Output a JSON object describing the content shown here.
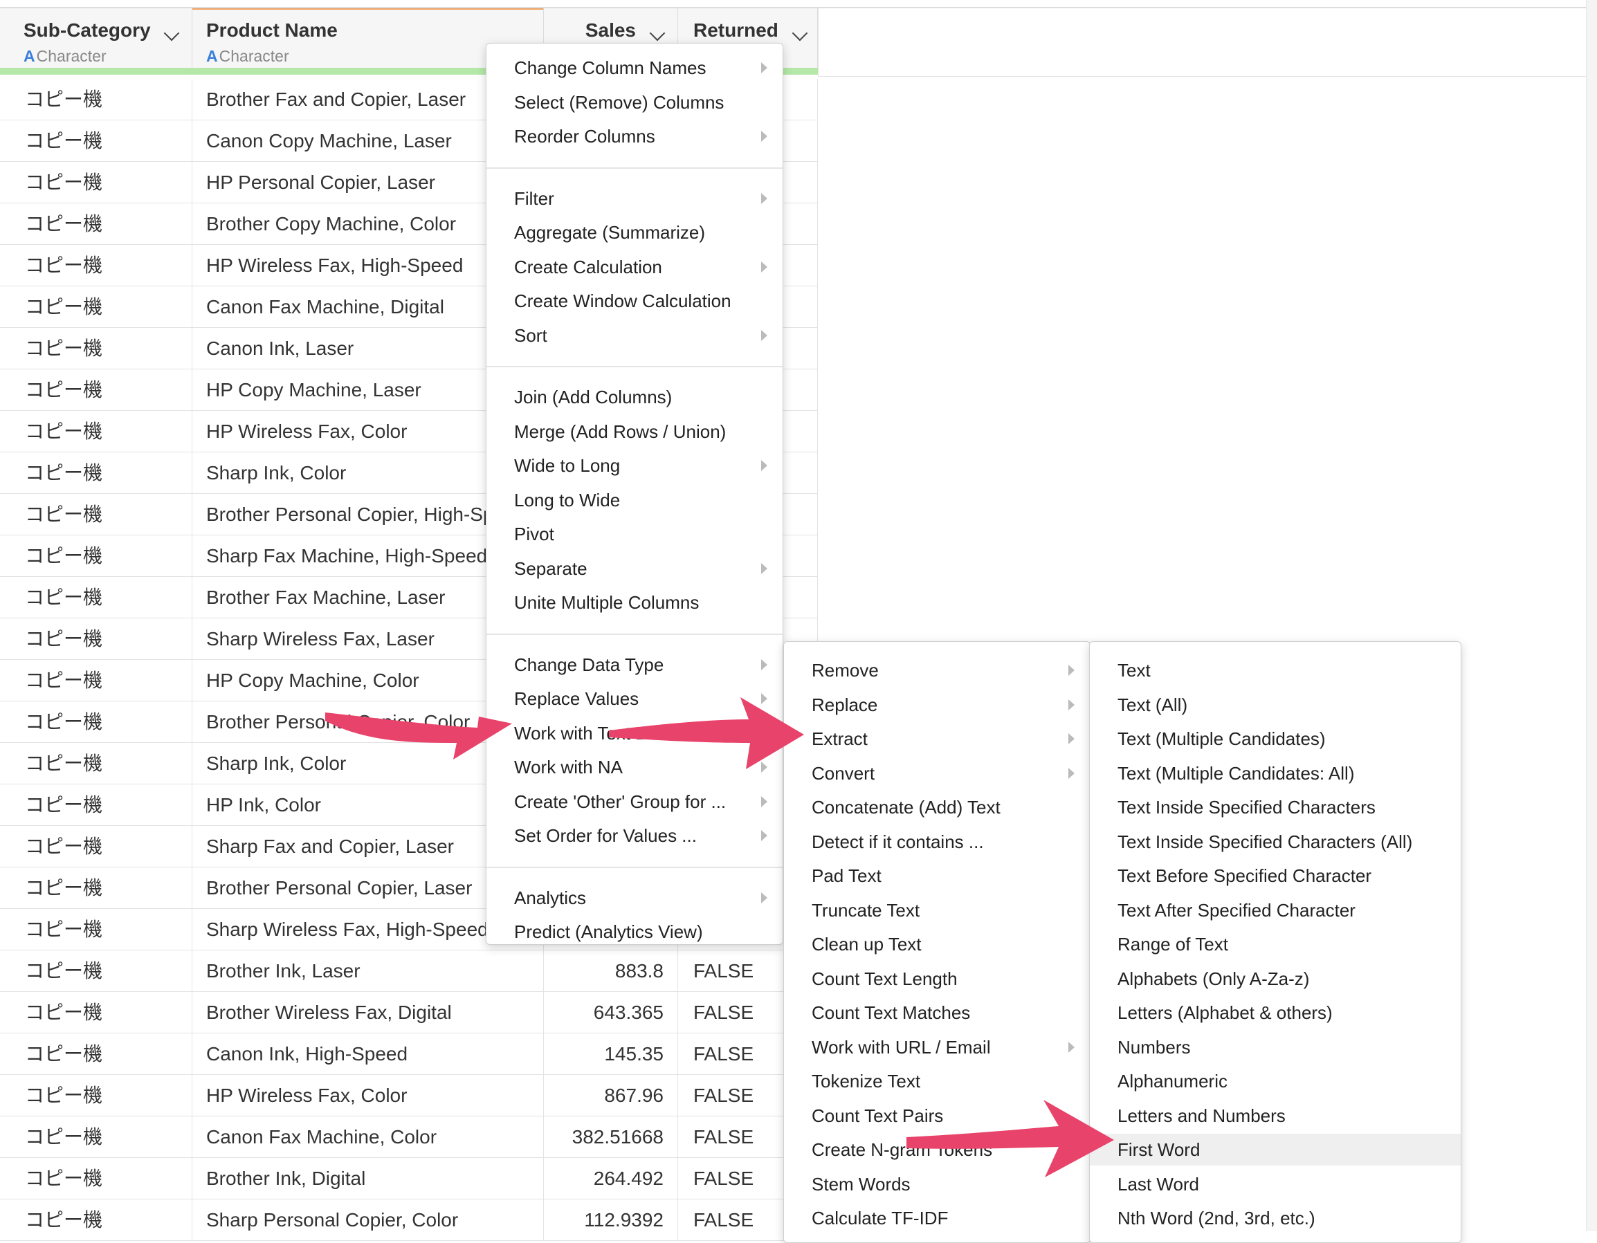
{
  "columns": [
    {
      "name": "Sub-Category",
      "type_letter": "A",
      "type": "Character"
    },
    {
      "name": "Product Name",
      "type_letter": "A",
      "type": "Character"
    },
    {
      "name": "Sales"
    },
    {
      "name": "Returned"
    }
  ],
  "rows": [
    {
      "sub": "コピー機",
      "product": "Brother Fax and Copier, Laser",
      "sales": "",
      "returned": ""
    },
    {
      "sub": "コピー機",
      "product": "Canon Copy Machine, Laser",
      "sales": "",
      "returned": ""
    },
    {
      "sub": "コピー機",
      "product": "HP Personal Copier, Laser",
      "sales": "",
      "returned": ""
    },
    {
      "sub": "コピー機",
      "product": "Brother Copy Machine, Color",
      "sales": "",
      "returned": ""
    },
    {
      "sub": "コピー機",
      "product": "HP Wireless Fax, High-Speed",
      "sales": "",
      "returned": ""
    },
    {
      "sub": "コピー機",
      "product": "Canon Fax Machine, Digital",
      "sales": "",
      "returned": ""
    },
    {
      "sub": "コピー機",
      "product": "Canon Ink, Laser",
      "sales": "",
      "returned": ""
    },
    {
      "sub": "コピー機",
      "product": "HP Copy Machine, Laser",
      "sales": "",
      "returned": ""
    },
    {
      "sub": "コピー機",
      "product": "HP Wireless Fax, Color",
      "sales": "",
      "returned": ""
    },
    {
      "sub": "コピー機",
      "product": "Sharp Ink, Color",
      "sales": "",
      "returned": ""
    },
    {
      "sub": "コピー機",
      "product": "Brother Personal Copier, High-Speed",
      "sales": "",
      "returned": ""
    },
    {
      "sub": "コピー機",
      "product": "Sharp Fax Machine, High-Speed",
      "sales": "",
      "returned": ""
    },
    {
      "sub": "コピー機",
      "product": "Brother Fax Machine, Laser",
      "sales": "",
      "returned": ""
    },
    {
      "sub": "コピー機",
      "product": "Sharp Wireless Fax, Laser",
      "sales": "",
      "returned": ""
    },
    {
      "sub": "コピー機",
      "product": "HP Copy Machine, Color",
      "sales": "",
      "returned": ""
    },
    {
      "sub": "コピー機",
      "product": "Brother Personal Copier, Color",
      "sales": "",
      "returned": ""
    },
    {
      "sub": "コピー機",
      "product": "Sharp Ink, Color",
      "sales": "",
      "returned": ""
    },
    {
      "sub": "コピー機",
      "product": "HP Ink, Color",
      "sales": "",
      "returned": ""
    },
    {
      "sub": "コピー機",
      "product": "Sharp Fax and Copier, Laser",
      "sales": "",
      "returned": ""
    },
    {
      "sub": "コピー機",
      "product": "Brother Personal Copier, Laser",
      "sales": "",
      "returned": ""
    },
    {
      "sub": "コピー機",
      "product": "Sharp Wireless Fax, High-Speed",
      "sales": "",
      "returned": ""
    },
    {
      "sub": "コピー機",
      "product": "Brother Ink, Laser",
      "sales": "883.8",
      "returned": "FALSE"
    },
    {
      "sub": "コピー機",
      "product": "Brother Wireless Fax, Digital",
      "sales": "643.365",
      "returned": "FALSE"
    },
    {
      "sub": "コピー機",
      "product": "Canon Ink, High-Speed",
      "sales": "145.35",
      "returned": "FALSE"
    },
    {
      "sub": "コピー機",
      "product": "HP Wireless Fax, Color",
      "sales": "867.96",
      "returned": "FALSE"
    },
    {
      "sub": "コピー機",
      "product": "Canon Fax Machine, Color",
      "sales": "382.51668",
      "returned": "FALSE"
    },
    {
      "sub": "コピー機",
      "product": "Brother Ink, Digital",
      "sales": "264.492",
      "returned": "FALSE"
    },
    {
      "sub": "コピー機",
      "product": "Sharp Personal Copier, Color",
      "sales": "112.9392",
      "returned": "FALSE"
    }
  ],
  "menu_main": [
    [
      {
        "label": "Change Column Names",
        "sub": true
      },
      {
        "label": "Select (Remove) Columns",
        "sub": false
      },
      {
        "label": "Reorder Columns",
        "sub": true
      }
    ],
    [
      {
        "label": "Filter",
        "sub": true
      },
      {
        "label": "Aggregate (Summarize)",
        "sub": false
      },
      {
        "label": "Create Calculation",
        "sub": true
      },
      {
        "label": "Create Window Calculation",
        "sub": false
      },
      {
        "label": "Sort",
        "sub": true
      }
    ],
    [
      {
        "label": "Join (Add Columns)",
        "sub": false
      },
      {
        "label": "Merge (Add Rows / Union)",
        "sub": false
      },
      {
        "label": "Wide to Long",
        "sub": true
      },
      {
        "label": "Long to Wide",
        "sub": false
      },
      {
        "label": "Pivot",
        "sub": false
      },
      {
        "label": "Separate",
        "sub": true
      },
      {
        "label": "Unite Multiple Columns",
        "sub": false
      }
    ],
    [
      {
        "label": "Change Data Type",
        "sub": true
      },
      {
        "label": "Replace Values",
        "sub": true
      },
      {
        "label": "Work with Text Data",
        "sub": true
      },
      {
        "label": "Work with NA",
        "sub": true
      },
      {
        "label": "Create 'Other' Group for ...",
        "sub": true
      },
      {
        "label": "Set Order for Values ...",
        "sub": true
      }
    ],
    [
      {
        "label": "Analytics",
        "sub": true
      },
      {
        "label": "Predict (Analytics View)",
        "sub": false
      }
    ]
  ],
  "menu_text": [
    {
      "label": "Remove",
      "sub": true
    },
    {
      "label": "Replace",
      "sub": true
    },
    {
      "label": "Extract",
      "sub": true
    },
    {
      "label": "Convert",
      "sub": true
    },
    {
      "label": "Concatenate (Add) Text",
      "sub": false
    },
    {
      "label": "Detect if it contains ...",
      "sub": false
    },
    {
      "label": "Pad Text",
      "sub": false
    },
    {
      "label": "Truncate Text",
      "sub": false
    },
    {
      "label": "Clean up Text",
      "sub": false
    },
    {
      "label": "Count Text Length",
      "sub": false
    },
    {
      "label": "Count Text Matches",
      "sub": false
    },
    {
      "label": "Work with URL / Email",
      "sub": true
    },
    {
      "label": "Tokenize Text",
      "sub": false
    },
    {
      "label": "Count Text Pairs",
      "sub": false
    },
    {
      "label": "Create N-gram Tokens",
      "sub": false
    },
    {
      "label": "Stem Words",
      "sub": false
    },
    {
      "label": "Calculate TF-IDF",
      "sub": false
    }
  ],
  "menu_extract": [
    {
      "label": "Text",
      "highlighted": false
    },
    {
      "label": "Text (All)",
      "highlighted": false
    },
    {
      "label": "Text (Multiple Candidates)",
      "highlighted": false
    },
    {
      "label": "Text (Multiple Candidates: All)",
      "highlighted": false
    },
    {
      "label": "Text Inside Specified Characters",
      "highlighted": false
    },
    {
      "label": "Text Inside Specified Characters (All)",
      "highlighted": false
    },
    {
      "label": "Text Before Specified Character",
      "highlighted": false
    },
    {
      "label": "Text After Specified Character",
      "highlighted": false
    },
    {
      "label": "Range of Text",
      "highlighted": false
    },
    {
      "label": "Alphabets (Only A-Za-z)",
      "highlighted": false
    },
    {
      "label": "Letters (Alphabet & others)",
      "highlighted": false
    },
    {
      "label": "Numbers",
      "highlighted": false
    },
    {
      "label": "Alphanumeric",
      "highlighted": false
    },
    {
      "label": "Letters and Numbers",
      "highlighted": false
    },
    {
      "label": "First Word",
      "highlighted": true
    },
    {
      "label": "Last Word",
      "highlighted": false
    },
    {
      "label": "Nth Word (2nd, 3rd, etc.)",
      "highlighted": false
    }
  ],
  "colors": {
    "arrow": "#e8436a",
    "header_bar": "#b5e8a8",
    "active_col": "#f0a060",
    "type_icon": "#3b7fd9"
  }
}
